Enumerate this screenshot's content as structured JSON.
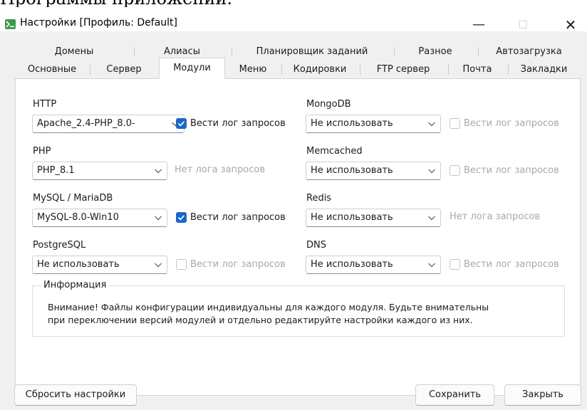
{
  "above_window_text": "Программы приложений.",
  "window": {
    "title": "Настройки [Профиль: Default]",
    "icon": "terminal-app-icon",
    "controls": {
      "minimize": "—",
      "maximize": "☐",
      "close": "✕"
    }
  },
  "tabs": {
    "row1": [
      "Домены",
      "Алиасы",
      "Планировщик заданий",
      "Разное",
      "Автозагрузка"
    ],
    "row2": [
      "Основные",
      "Сервер",
      "Модули",
      "Меню",
      "Кодировки",
      "FTP сервер",
      "Почта",
      "Закладки"
    ],
    "active": "Модули"
  },
  "modules": {
    "http": {
      "label": "HTTP",
      "value": "Apache_2.4-PHP_8.0-",
      "log_label": "Вести лог запросов",
      "log_checked": true
    },
    "php": {
      "label": "PHP",
      "value": "PHP_8.1",
      "nolog_label": "Нет лога запросов"
    },
    "mysql": {
      "label": "MySQL / MariaDB",
      "value": "MySQL-8.0-Win10",
      "log_label": "Вести лог запросов",
      "log_checked": true
    },
    "postgresql": {
      "label": "PostgreSQL",
      "value": "Не использовать",
      "log_label": "Вести лог запросов",
      "log_checked": false
    },
    "mongodb": {
      "label": "MongoDB",
      "value": "Не использовать",
      "log_label": "Вести лог запросов",
      "log_checked": false
    },
    "memcached": {
      "label": "Memcached",
      "value": "Не использовать",
      "log_label": "Вести лог запросов",
      "log_checked": false
    },
    "redis": {
      "label": "Redis",
      "value": "Не использовать",
      "nolog_label": "Нет лога запросов"
    },
    "dns": {
      "label": "DNS",
      "value": "Не использовать",
      "log_label": "Вести лог запросов",
      "log_checked": false
    }
  },
  "info": {
    "title": "Информация",
    "line1": "Внимание! Файлы конфигурации индивидуальны для каждого модуля. Будьте внимательны",
    "line2": "при переключении версий модулей и отдельно редактируйте настройки каждого из них."
  },
  "buttons": {
    "reset": "Сбросить настройки",
    "save": "Сохранить",
    "close": "Закрыть"
  },
  "colors": {
    "accent": "#1a66c9",
    "dialog_bg": "#f0f0f0",
    "app_icon": "#3b9a4c"
  }
}
